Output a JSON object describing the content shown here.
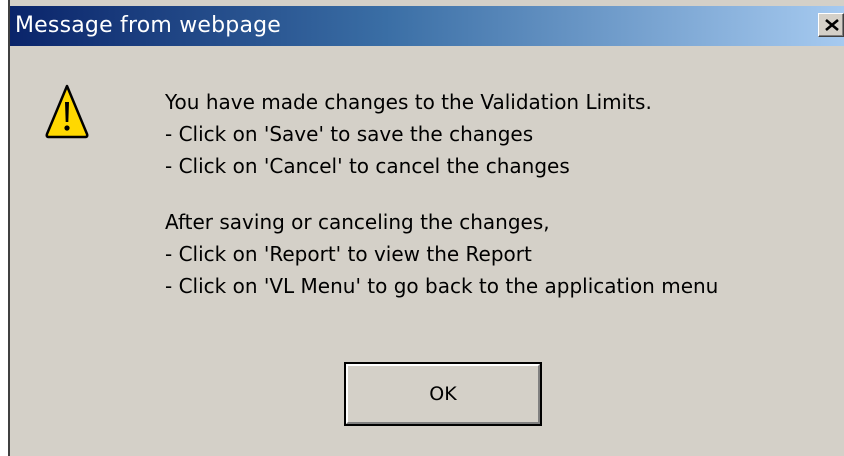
{
  "dialog": {
    "title": "Message from webpage",
    "close_icon": "close-icon",
    "icon": "warning-icon",
    "message_lines": [
      "You have made changes to the Validation Limits.",
      "- Click on 'Save' to save the changes",
      "- Click on 'Cancel' to cancel the changes",
      "After saving or canceling the changes,",
      "- Click on 'Report' to view the Report",
      "- Click on 'VL Menu' to go back to the application menu"
    ],
    "ok_label": "OK"
  },
  "colors": {
    "titlebar_start": "#0a246a",
    "titlebar_end": "#a6caf0",
    "face": "#d4d0c8",
    "warning_yellow": "#ffd800"
  }
}
